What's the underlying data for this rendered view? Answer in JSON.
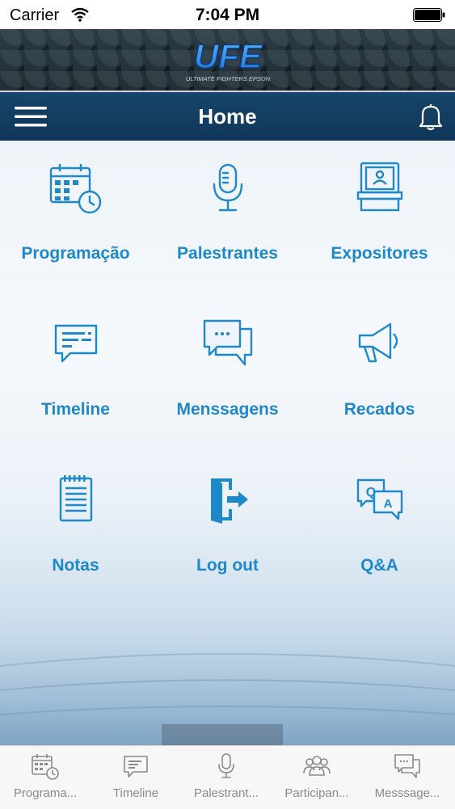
{
  "status_bar": {
    "carrier": "Carrier",
    "time": "7:04 PM"
  },
  "brand": {
    "logo_text": "UFE",
    "logo_subtitle": "ULTIMATE FIGHTERS EPSON"
  },
  "nav": {
    "title": "Home",
    "menu_icon": "hamburger-icon",
    "notification_icon": "bell-icon"
  },
  "colors": {
    "accent": "#1e88c8",
    "navbar": "#123f63",
    "tab_label": "#8a8a8a"
  },
  "grid": {
    "items": [
      {
        "label": "Programação",
        "icon": "calendar-clock-icon"
      },
      {
        "label": "Palestrantes",
        "icon": "microphone-icon"
      },
      {
        "label": "Expositores",
        "icon": "exhibitor-booth-icon"
      },
      {
        "label": "Timeline",
        "icon": "message-bubble-icon"
      },
      {
        "label": "Menssagens",
        "icon": "chat-bubbles-icon"
      },
      {
        "label": "Recados",
        "icon": "megaphone-icon"
      },
      {
        "label": "Notas",
        "icon": "notepad-icon"
      },
      {
        "label": "Log out",
        "icon": "exit-door-icon"
      },
      {
        "label": "Q&A",
        "icon": "qa-bubbles-icon"
      }
    ]
  },
  "tabbar": {
    "items": [
      {
        "label": "Programa...",
        "icon": "calendar-clock-icon"
      },
      {
        "label": "Timeline",
        "icon": "message-bubble-icon"
      },
      {
        "label": "Palestrant...",
        "icon": "microphone-icon"
      },
      {
        "label": "Participan...",
        "icon": "people-icon"
      },
      {
        "label": "Messsage...",
        "icon": "chat-bubbles-icon"
      }
    ]
  }
}
